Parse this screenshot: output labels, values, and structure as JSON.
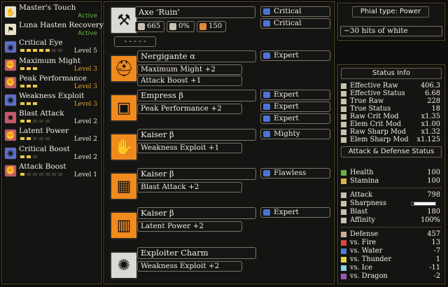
{
  "skills": [
    {
      "name": "Master's Touch",
      "level": "Active",
      "level_style": "active",
      "pips_on": 0,
      "pips_total": 0,
      "icon": "gauntlet-icon",
      "icon_color": "#e8e2c8",
      "icon_glyph": "✋"
    },
    {
      "name": "Luna Hasten Recovery",
      "level": "Active",
      "level_style": "active",
      "pips_on": 0,
      "pips_total": 0,
      "icon": "boot-icon",
      "icon_color": "#e8e2c8",
      "icon_glyph": "⚑"
    },
    {
      "name": "Critical Eye",
      "level": "Level 5",
      "level_style": "white",
      "pips_on": 5,
      "pips_total": 7,
      "icon": "eye-icon",
      "icon_color": "#5d6fc4",
      "icon_glyph": "◉"
    },
    {
      "name": "Maximum Might",
      "level": "Level 3",
      "level_style": "orange",
      "pips_on": 3,
      "pips_total": 3,
      "icon": "fist-icon",
      "icon_color": "#c5596a",
      "icon_glyph": "✊"
    },
    {
      "name": "Peak Performance",
      "level": "Level 3",
      "level_style": "orange",
      "pips_on": 3,
      "pips_total": 3,
      "icon": "fist-icon",
      "icon_color": "#c5596a",
      "icon_glyph": "✊"
    },
    {
      "name": "Weakness Exploit",
      "level": "Level 3",
      "level_style": "orange",
      "pips_on": 3,
      "pips_total": 3,
      "icon": "eye-icon",
      "icon_color": "#5d6fc4",
      "icon_glyph": "◉"
    },
    {
      "name": "Blast Attack",
      "level": "Level 2",
      "level_style": "white",
      "pips_on": 2,
      "pips_total": 5,
      "icon": "blast-icon",
      "icon_color": "#c5596a",
      "icon_glyph": "✸"
    },
    {
      "name": "Latent Power",
      "level": "Level 2",
      "level_style": "white",
      "pips_on": 2,
      "pips_total": 5,
      "icon": "fist-icon",
      "icon_color": "#c5596a",
      "icon_glyph": "✊"
    },
    {
      "name": "Critical Boost",
      "level": "Level 2",
      "level_style": "white",
      "pips_on": 2,
      "pips_total": 3,
      "icon": "eye-icon",
      "icon_color": "#5d6fc4",
      "icon_glyph": "◉"
    },
    {
      "name": "Attack Boost",
      "level": "Level 1",
      "level_style": "white",
      "pips_on": 1,
      "pips_total": 7,
      "icon": "fist-icon",
      "icon_color": "#c5596a",
      "icon_glyph": "✊"
    }
  ],
  "weapon": {
    "name": "Axe 'Ruin'",
    "icon": "switch-axe-icon",
    "attack": "665",
    "affinity": "0%",
    "element": "150",
    "deco_slot": "- - - - -",
    "decorations": [
      "Critical",
      "Critical"
    ]
  },
  "armor": [
    {
      "name": "Nergigante α",
      "skills": [
        "Maximum Might +2",
        "Attack Boost +1"
      ],
      "decorations": [
        "Expert"
      ],
      "icon": "helm-icon"
    },
    {
      "name": "Empress β",
      "skills": [
        "Peak Performance +2"
      ],
      "decorations": [
        "Expert",
        "Expert",
        "Expert"
      ],
      "icon": "chest-icon"
    },
    {
      "name": "Kaiser β",
      "skills": [
        "Weakness Exploit +1"
      ],
      "decorations": [
        "Mighty"
      ],
      "icon": "arm-icon"
    },
    {
      "name": "Kaiser β",
      "skills": [
        "Blast Attack +2"
      ],
      "decorations": [
        "Flawless"
      ],
      "icon": "waist-icon"
    },
    {
      "name": "Kaiser β",
      "skills": [
        "Latent Power +2"
      ],
      "decorations": [
        "Expert"
      ],
      "icon": "legs-icon"
    },
    {
      "name": "Exploiter Charm",
      "skills": [
        "Weakness Exploit +2"
      ],
      "decorations": [],
      "icon": "charm-icon"
    }
  ],
  "phial": {
    "title": "Phial type: Power",
    "note": "~30 hits of white"
  },
  "status_info": {
    "header": "Status Info",
    "rows": [
      {
        "label": "Effective Raw",
        "value": "406.3",
        "icon": "sword-icon",
        "color": "#c8c2b0"
      },
      {
        "label": "Effective Status",
        "value": "6.68",
        "icon": "sword-icon",
        "color": "#c8c2b0"
      },
      {
        "label": "True Raw",
        "value": "228",
        "icon": "sword-icon",
        "color": "#c8c2b0"
      },
      {
        "label": "True Status",
        "value": "18",
        "icon": "sword-icon",
        "color": "#c8c2b0"
      },
      {
        "label": "Raw Crit Mod",
        "value": "x1.35",
        "icon": "sword-icon",
        "color": "#c8c2b0"
      },
      {
        "label": "Elem Crit Mod",
        "value": "x1.00",
        "icon": "sword-icon",
        "color": "#c8c2b0"
      },
      {
        "label": "Raw Sharp Mod",
        "value": "x1.32",
        "icon": "sword-icon",
        "color": "#c8c2b0"
      },
      {
        "label": "Elem Sharp Mod",
        "value": "x1.125",
        "icon": "sword-icon",
        "color": "#c8c2b0"
      }
    ]
  },
  "attack_defense": {
    "header": "Attack & Defense Status",
    "vitals": [
      {
        "label": "Health",
        "value": "100",
        "icon": "health-icon",
        "color": "#6cb04a"
      },
      {
        "label": "Stamina",
        "value": "100",
        "icon": "stamina-icon",
        "color": "#d8b64a"
      }
    ],
    "offense": [
      {
        "label": "Attack",
        "value": "798",
        "icon": "sword-icon",
        "color": "#c8c2b0"
      },
      {
        "label": "Sharpness",
        "value": "",
        "icon": "sharpness-icon",
        "color": "#c8c2b0"
      },
      {
        "label": "Blast",
        "value": "180",
        "icon": "blast-icon",
        "color": "#c8c2b0"
      },
      {
        "label": "Affinity",
        "value": "100%",
        "icon": "affinity-icon",
        "color": "#c8c2b0"
      }
    ],
    "defense": [
      {
        "label": "Defense",
        "value": "457",
        "icon": "shield-icon",
        "color": "#c8b090"
      },
      {
        "label": "vs. Fire",
        "value": "13",
        "icon": "fire-icon",
        "color": "#d8483a"
      },
      {
        "label": "vs. Water",
        "value": "-7",
        "icon": "water-icon",
        "color": "#4a7ed8"
      },
      {
        "label": "vs. Thunder",
        "value": "1",
        "icon": "thunder-icon",
        "color": "#e6d24a"
      },
      {
        "label": "vs. Ice",
        "value": "-11",
        "icon": "ice-icon",
        "color": "#8ad0e0"
      },
      {
        "label": "vs. Dragon",
        "value": "-2",
        "icon": "dragon-icon",
        "color": "#9a5ab8"
      }
    ]
  }
}
